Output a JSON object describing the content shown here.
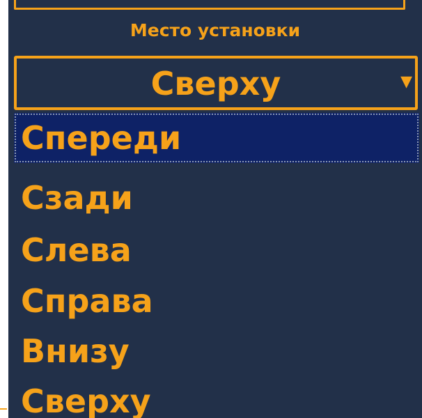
{
  "field": {
    "label": "Место установки",
    "selected_value": "Сверху",
    "arrow_icon": "triangle-down"
  },
  "dropdown": {
    "options": [
      {
        "label": "Спереди",
        "highlighted": true
      },
      {
        "label": "Сзади",
        "highlighted": false
      },
      {
        "label": "Слева",
        "highlighted": false
      },
      {
        "label": "Справа",
        "highlighted": false
      },
      {
        "label": "Внизу",
        "highlighted": false
      },
      {
        "label": "Сверху",
        "highlighted": false
      }
    ]
  },
  "colors": {
    "panel_background": "#223049",
    "accent": "#f6a21a",
    "highlight": "#0e2266"
  }
}
